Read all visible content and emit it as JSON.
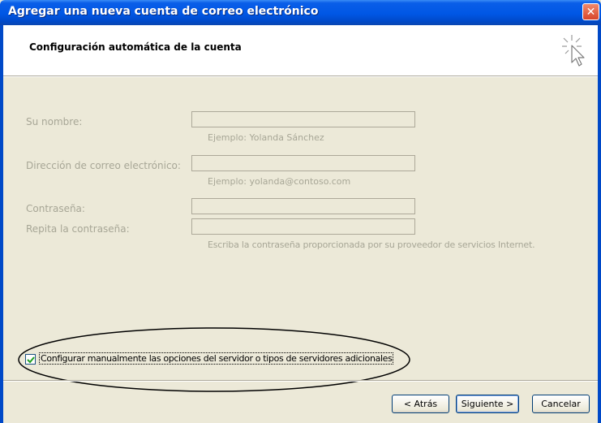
{
  "window": {
    "title": "Agregar una nueva cuenta de correo electrónico",
    "close_glyph": "✕"
  },
  "header": {
    "title": "Configuración automática de la cuenta",
    "icon": "cursor-sparkle-icon"
  },
  "form": {
    "name_label": "Su nombre:",
    "name_value": "",
    "name_hint": "Ejemplo: Yolanda Sánchez",
    "email_label": "Dirección de correo electrónico:",
    "email_value": "",
    "email_hint": "Ejemplo: yolanda@contoso.com",
    "password_label": "Contraseña:",
    "password_value": "",
    "repeat_label": "Repita la contraseña:",
    "repeat_value": "",
    "password_hint": "Escriba la contraseña proporcionada por su proveedor de servicios Internet."
  },
  "manual_config": {
    "label": "Configurar manualmente las opciones del servidor o tipos de servidores adicionales",
    "checked": true
  },
  "buttons": {
    "back": "< Atrás",
    "next": "Siguiente >",
    "cancel": "Cancelar"
  },
  "colors": {
    "title_bar": "#0054e3",
    "disabled_text": "#a7a696",
    "dialog_bg": "#ece9d8"
  }
}
